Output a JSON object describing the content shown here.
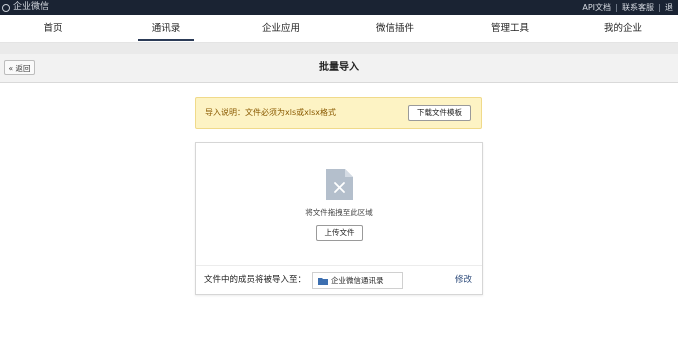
{
  "topbar": {
    "app_name": "企业微信",
    "links": [
      "API文档",
      "联系客服",
      "退"
    ]
  },
  "nav": {
    "items": [
      {
        "label": "首页",
        "active": false
      },
      {
        "label": "通讯录",
        "active": true
      },
      {
        "label": "企业应用",
        "active": false
      },
      {
        "label": "微信插件",
        "active": false
      },
      {
        "label": "管理工具",
        "active": false
      },
      {
        "label": "我的企业",
        "active": false
      }
    ]
  },
  "subheader": {
    "back_label": "« 返回",
    "title": "批量导入"
  },
  "notice": {
    "text": "导入说明：文件必须为xls或xlsx格式",
    "download_label": "下载文件模板"
  },
  "upload": {
    "drop_hint": "将文件拖拽至此区域",
    "upload_label": "上传文件",
    "import_label": "文件中的成员将被导入至：",
    "destination": "企业微信通讯录",
    "modify_label": "修改"
  },
  "colors": {
    "topbar_bg": "#1a2333",
    "notice_bg": "#fdf3c4",
    "notice_text": "#8a5a00",
    "link": "#2c4a7a",
    "file_icon": "#b4bfcc",
    "folder_icon": "#3d6fb0"
  }
}
